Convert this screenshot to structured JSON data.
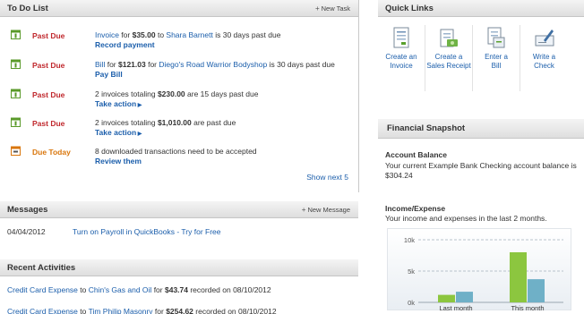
{
  "todo": {
    "title": "To Do List",
    "new_task": "New Task",
    "items": [
      {
        "status": "Past Due",
        "status_type": "past",
        "pre": "",
        "link1": "Invoice",
        "mid1": " for ",
        "amount": "$35.00",
        "mid2": " to ",
        "link2": "Shara Barnett",
        "post": " is 30 days past due",
        "action": "Record payment",
        "icon": "calendar-icon"
      },
      {
        "status": "Past Due",
        "status_type": "past",
        "pre": "",
        "link1": "Bill",
        "mid1": " for ",
        "amount": "$121.03",
        "mid2": " for ",
        "link2": "Diego's Road Warrior Bodyshop",
        "post": " is 30 days past due",
        "action": "Pay Bill",
        "icon": "calendar-icon"
      },
      {
        "status": "Past Due",
        "status_type": "past",
        "pre": "2 invoices totaling ",
        "link1": "",
        "mid1": "",
        "amount": "$230.00",
        "mid2": "",
        "link2": "",
        "post": " are 15 days past due",
        "action": "Take action",
        "icon": "calendar-icon"
      },
      {
        "status": "Past Due",
        "status_type": "past",
        "pre": "2 invoices totaling ",
        "link1": "",
        "mid1": "",
        "amount": "$1,010.00",
        "mid2": "",
        "link2": "",
        "post": " are past due",
        "action": "Take action",
        "icon": "calendar-icon"
      },
      {
        "status": "Due Today",
        "status_type": "today",
        "pre": "8 downloaded transactions need to be accepted",
        "link1": "",
        "mid1": "",
        "amount": "",
        "mid2": "",
        "link2": "",
        "post": "",
        "action": "Review them",
        "icon": "download-calendar-icon"
      }
    ],
    "show_next": "Show next 5"
  },
  "messages": {
    "title": "Messages",
    "new_message": "New Message",
    "items": [
      {
        "date": "04/04/2012",
        "text": "Turn on Payroll in QuickBooks - Try for Free"
      }
    ]
  },
  "recent": {
    "title": "Recent Activities",
    "items": [
      {
        "link": "Credit Card Expense",
        "mid": " to ",
        "link2": "Chin's Gas and Oil",
        "amount_pre": " for ",
        "amount": "$43.74",
        "post": " recorded on 08/10/2012"
      },
      {
        "link": "Credit Card Expense",
        "mid": " to ",
        "link2": "Tim Philip Masonry",
        "amount_pre": " for ",
        "amount": "$254.62",
        "post": " recorded on 08/10/2012"
      }
    ]
  },
  "quick_links": {
    "title": "Quick Links",
    "items": [
      {
        "line1": "Create an",
        "line2": "Invoice",
        "icon": "invoice-icon"
      },
      {
        "line1": "Create a",
        "line2": "Sales Receipt",
        "icon": "sales-receipt-icon"
      },
      {
        "line1": "Enter a",
        "line2": "Bill",
        "icon": "bill-icon"
      },
      {
        "line1": "Write a",
        "line2": "Check",
        "icon": "check-icon"
      }
    ]
  },
  "snapshot": {
    "title": "Financial Snapshot",
    "account_heading": "Account Balance",
    "account_text_1": "Your current Example Bank Checking account balance is",
    "account_text_2": "$304.24",
    "income_heading": "Income/Expense",
    "income_text": "Your income and expenses in the last 2 months."
  },
  "chart_data": {
    "type": "bar",
    "categories": [
      "Last month",
      "This month"
    ],
    "series": [
      {
        "values": [
          1200,
          8000
        ],
        "color": "#8cc63f"
      },
      {
        "values": [
          1700,
          3700
        ],
        "color": "#6fb0c7"
      }
    ],
    "yticks": [
      "0k",
      "5k",
      "10k"
    ],
    "ylim": [
      0,
      10000
    ],
    "grid": true
  }
}
